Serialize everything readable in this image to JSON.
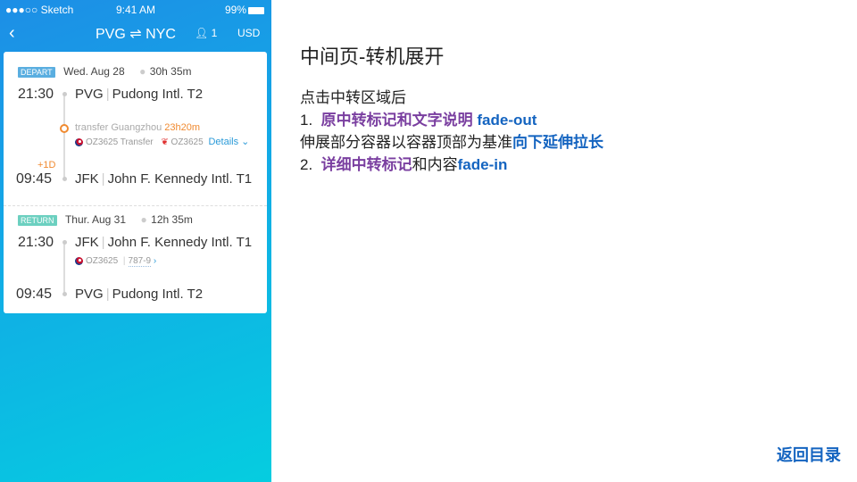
{
  "status": {
    "carrier": "●●●○○ Sketch",
    "time": "9:41 AM",
    "battery": "99%"
  },
  "nav": {
    "back": "‹",
    "route": "PVG ⇌ NYC",
    "passengers": "1",
    "currency": "USD"
  },
  "depart": {
    "tag": "DEPART",
    "date": "Wed. Aug 28",
    "duration": "30h 35m",
    "dep_time": "21:30",
    "dep_code": "PVG",
    "dep_airport": "Pudong Intl. T2",
    "transfer_label": "transfer Guangzhou",
    "transfer_time": "23h20m",
    "flight1": "OZ3625 Transfer",
    "flight2": "OZ3625",
    "details": "Details",
    "day_offset": "+1D",
    "arr_time": "09:45",
    "arr_code": "JFK",
    "arr_airport": "John F. Kennedy Intl. T1"
  },
  "return": {
    "tag": "RETURN",
    "date": "Thur. Aug 31",
    "duration": "12h 35m",
    "dep_time": "21:30",
    "dep_code": "JFK",
    "dep_airport": "John F. Kennedy Intl. T1",
    "flight": "OZ3625",
    "aircraft": "787-9",
    "arr_time": "09:45",
    "arr_code": "PVG",
    "arr_airport": "Pudong Intl. T2"
  },
  "colors": {
    "depart_tag": "#5aaee0",
    "return_tag": "#6cd0c0",
    "orange": "#f08a30",
    "link": "#2a9ad8",
    "purple": "#7a3fa0",
    "blue": "#1464c0"
  },
  "notes": {
    "title": "中间页-转机展开",
    "line0": "点击中转区域后",
    "l1_num": "1.",
    "l1_purple": "原中转标记和文字说明",
    "l1_blue": "fade-out",
    "l2_text": "伸展部分容器以容器顶部为基准",
    "l2_blue": "向下延伸拉长",
    "l3_num": "2.",
    "l3_purple": "详细中转标记",
    "l3_text": "和内容",
    "l3_blue": "fade-in"
  },
  "back_to_toc": "返回目录"
}
